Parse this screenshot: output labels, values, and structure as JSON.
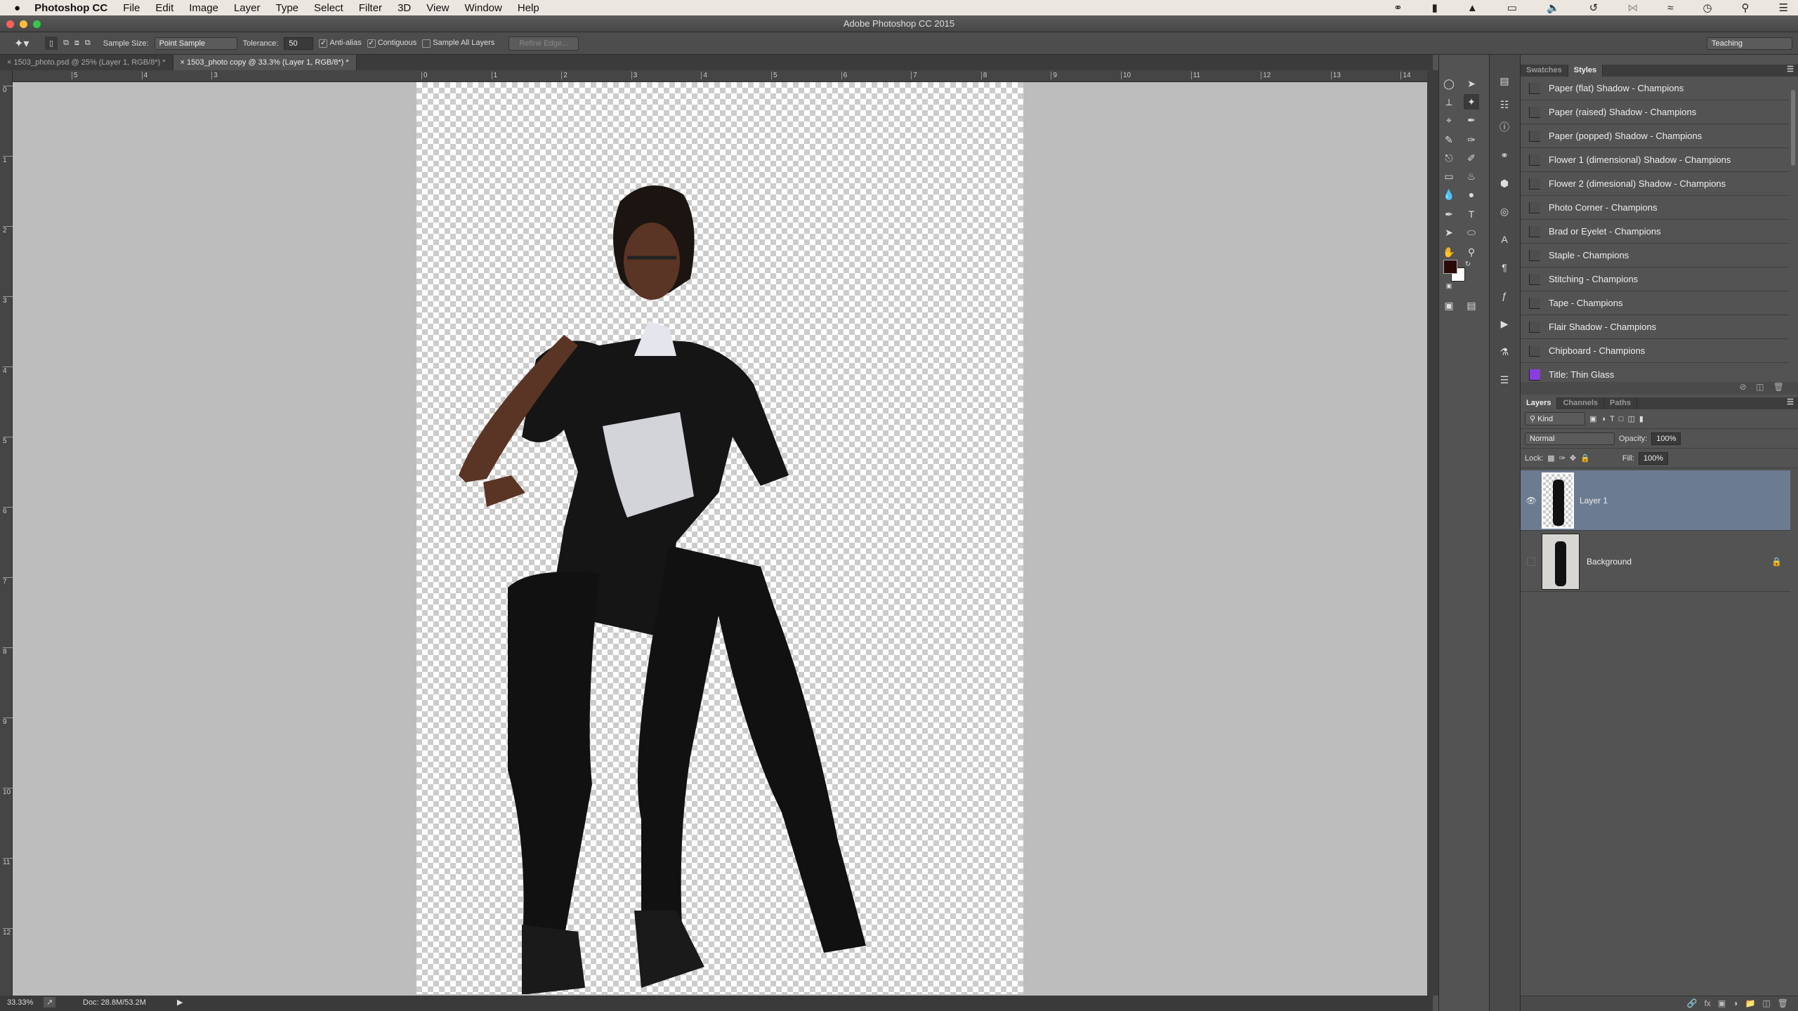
{
  "menubar": {
    "apple": "",
    "app": "Photoshop CC",
    "items": [
      "File",
      "Edit",
      "Image",
      "Layer",
      "Type",
      "Select",
      "Filter",
      "3D",
      "View",
      "Window",
      "Help"
    ],
    "status_icons": [
      "creative-cloud-icon",
      "bookmark-icon",
      "notification-bell-icon",
      "airplay-icon",
      "volume-icon",
      "time-machine-icon",
      "bluetooth-icon",
      "wifi-icon",
      "clock-icon",
      "spotlight-search-icon",
      "notification-center-icon"
    ]
  },
  "window": {
    "title": "Adobe Photoshop CC 2015"
  },
  "options": {
    "sample_size_label": "Sample Size:",
    "sample_size_value": "Point Sample",
    "tolerance_label": "Tolerance:",
    "tolerance_value": "50",
    "anti_alias": "Anti-alias",
    "anti_alias_checked": true,
    "contiguous": "Contiguous",
    "contiguous_checked": true,
    "sample_all": "Sample All Layers",
    "sample_all_checked": false,
    "refine_edge": "Refine Edge...",
    "workspace": "Teaching"
  },
  "tabs": [
    {
      "label": "1503_photo.psd @ 25% (Layer 1, RGB/8*) *",
      "active": false
    },
    {
      "label": "1503_photo copy @ 33.3% (Layer 1, RGB/8*) *",
      "active": true
    }
  ],
  "rulers": {
    "h_left": [
      "5",
      "4",
      "3"
    ],
    "h": [
      "0",
      "1",
      "2",
      "3",
      "4",
      "5",
      "6",
      "7",
      "8",
      "9",
      "10",
      "11",
      "12",
      "13",
      "14"
    ],
    "v": [
      "0",
      "1",
      "2",
      "3",
      "4",
      "5",
      "6",
      "7",
      "8",
      "9",
      "10",
      "11",
      "12"
    ]
  },
  "status": {
    "zoom": "33.33%",
    "doc": "Doc: 28.8M/53.2M"
  },
  "colors": {
    "foreground": "#2a0a06",
    "background": "#ffffff",
    "layer_selected": "#6b7b91",
    "title_glass": "#8a3ee0"
  },
  "styles_panel": {
    "tabs": [
      "Swatches",
      "Styles"
    ],
    "active": "Styles",
    "items": [
      "Paper (flat) Shadow - Champions",
      "Paper (raised) Shadow - Champions",
      "Paper (popped) Shadow - Champions",
      "Flower 1 (dimensional) Shadow - Champions",
      "Flower 2 (dimesional) Shadow - Champions",
      "Photo Corner - Champions",
      "Brad or Eyelet - Champions",
      "Staple - Champions",
      "Stitching - Champions",
      "Tape - Champions",
      "Flair Shadow - Champions",
      "Chipboard - Champions",
      "Title: Thin Glass"
    ]
  },
  "layers_panel": {
    "tabs": [
      "Layers",
      "Channels",
      "Paths"
    ],
    "active": "Layers",
    "filter": "Kind",
    "blend_mode": "Normal",
    "opacity_label": "Opacity:",
    "opacity": "100%",
    "lock_label": "Lock:",
    "fill_label": "Fill:",
    "fill": "100%",
    "layers": [
      {
        "name": "Layer 1",
        "visible": true,
        "selected": true,
        "locked": false
      },
      {
        "name": "Background",
        "visible": false,
        "selected": false,
        "locked": true
      }
    ]
  }
}
